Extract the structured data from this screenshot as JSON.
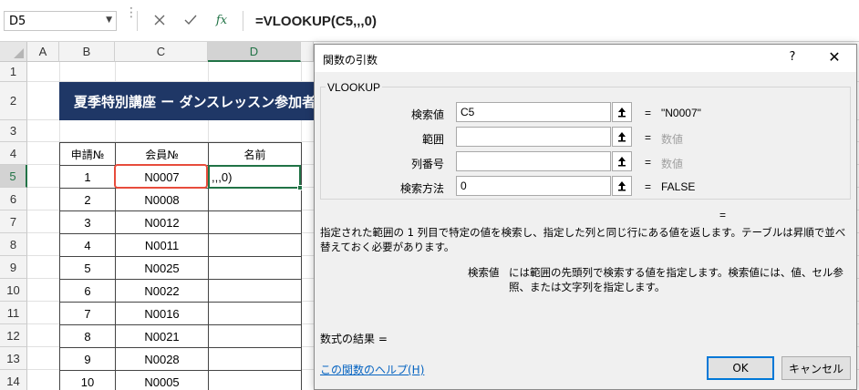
{
  "formula_bar": {
    "name_box": "D5",
    "formula": "=VLOOKUP(C5,,,0)",
    "cancel_icon": "close-icon",
    "enter_icon": "check-icon",
    "fx_label": "fx"
  },
  "grid": {
    "columns": [
      "A",
      "B",
      "C",
      "D"
    ],
    "rows": [
      "1",
      "2",
      "3",
      "4",
      "5",
      "6",
      "7",
      "8",
      "9",
      "10",
      "11",
      "12",
      "13",
      "14"
    ],
    "title_banner": "夏季特別講座 ー ダンスレッスン参加者",
    "table_headers": [
      "申請№",
      "会員№",
      "名前"
    ],
    "table_rows": [
      {
        "no": "1",
        "member": "N0007"
      },
      {
        "no": "2",
        "member": "N0008"
      },
      {
        "no": "3",
        "member": "N0012"
      },
      {
        "no": "4",
        "member": "N0011"
      },
      {
        "no": "5",
        "member": "N0025"
      },
      {
        "no": "6",
        "member": "N0022"
      },
      {
        "no": "7",
        "member": "N0016"
      },
      {
        "no": "8",
        "member": "N0021"
      },
      {
        "no": "9",
        "member": "N0028"
      },
      {
        "no": "10",
        "member": "N0005"
      }
    ],
    "editing_text": ",,,0)"
  },
  "dialog": {
    "title": "関数の引数",
    "help_glyph": "?",
    "close_glyph": "✕",
    "function_name": "VLOOKUP",
    "args": [
      {
        "label": "検索値",
        "value": "C5",
        "eq": "=",
        "result": "\"N0007\"",
        "hint": false
      },
      {
        "label": "範囲",
        "value": "",
        "eq": "=",
        "result": "数値",
        "hint": true
      },
      {
        "label": "列番号",
        "value": "",
        "eq": "=",
        "result": "数値",
        "hint": true
      },
      {
        "label": "検索方法",
        "value": "0",
        "eq": "=",
        "result": "FALSE",
        "hint": false
      }
    ],
    "overall_eq": "=",
    "description": "指定された範囲の 1 列目で特定の値を検索し、指定した列と同じ行にある値を返します。テーブルは昇順で並べ替えておく必要があります。",
    "arg_desc_name": "検索値",
    "arg_desc": "には範囲の先頭列で検索する値を指定します。検索値には、値、セル参照、または文字列を指定します。",
    "result_label": "数式の結果 =",
    "help_link": "この関数のヘルプ(H)",
    "ok_label": "OK",
    "cancel_label": "キャンセル"
  }
}
